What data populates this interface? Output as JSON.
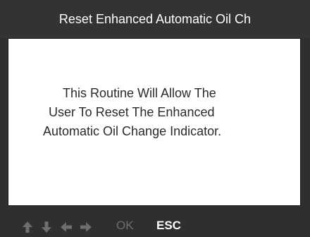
{
  "header": {
    "title": "Reset Enhanced Automatic Oil Ch"
  },
  "main": {
    "message_lines": [
      "This Routine Will Allow The",
      "User To Reset The Enhanced",
      "Automatic Oil Change Indicator."
    ]
  },
  "footer": {
    "arrows": [
      "up-arrow-icon",
      "down-arrow-icon",
      "left-arrow-icon",
      "right-arrow-icon"
    ],
    "ok_label": "OK",
    "esc_label": "ESC",
    "disabled_color": "#6e6e6e",
    "enabled_color": "#ffffff"
  }
}
